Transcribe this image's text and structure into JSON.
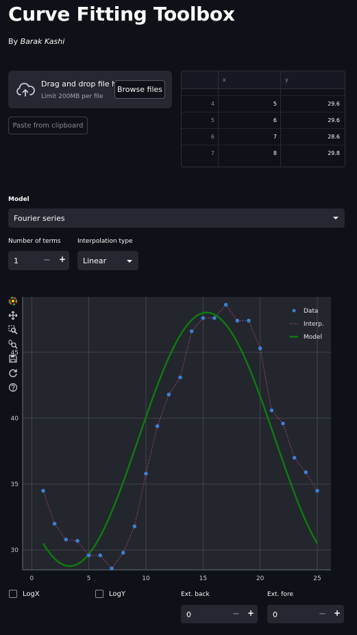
{
  "header": {
    "title": "Curve Fitting Toolbox",
    "by": "By",
    "author": "Barak Kashi"
  },
  "uploader": {
    "title": "Drag and drop file here",
    "limit": "Limit 200MB per file",
    "browse_label": "Browse files",
    "icon": "cloud-upload-icon"
  },
  "paste_label": "Paste from clipboard",
  "table": {
    "columns": [
      "",
      "x",
      "y"
    ],
    "rows": [
      {
        "idx": "4",
        "x": "5",
        "y": "29.6"
      },
      {
        "idx": "5",
        "x": "6",
        "y": "29.6"
      },
      {
        "idx": "6",
        "x": "7",
        "y": "28.6"
      },
      {
        "idx": "7",
        "x": "8",
        "y": "29.8"
      }
    ]
  },
  "model": {
    "label": "Model",
    "value": "Fourier series"
  },
  "nterms": {
    "label": "Number of terms",
    "value": "1",
    "minus": "−",
    "plus": "+"
  },
  "interp": {
    "label": "Interpolation type",
    "value": "Linear"
  },
  "options": {
    "logx": "LogX",
    "logy": "LogY",
    "ext_back": {
      "label": "Ext. back",
      "value": "0",
      "minus": "−",
      "plus": "+"
    },
    "ext_fore": {
      "label": "Ext. fore",
      "value": "0",
      "minus": "−",
      "plus": "+"
    }
  },
  "colors": {
    "data": "#3d7fd6",
    "interp": "#c94a8c",
    "model": "#0f7a0f",
    "plot_bg": "#23262d"
  },
  "toolbar_icons": [
    "bokeh-logo-icon",
    "pan-icon",
    "box-zoom-icon",
    "wheel-zoom-icon",
    "save-icon",
    "reset-icon",
    "help-icon"
  ],
  "chart_data": {
    "type": "scatter",
    "title": "",
    "xlabel": "",
    "ylabel": "",
    "xlim": [
      -0.8,
      26.2
    ],
    "ylim": [
      28.5,
      49.2
    ],
    "xticks": [
      0,
      5,
      10,
      15,
      20,
      25
    ],
    "yticks": [
      30,
      35,
      40,
      45
    ],
    "legend_position": "top-right",
    "series": [
      {
        "name": "Data",
        "kind": "points",
        "x": [
          1,
          2,
          3,
          4,
          5,
          6,
          7,
          8,
          9,
          10,
          11,
          12,
          13,
          14,
          15,
          16,
          17,
          18,
          19,
          20,
          21,
          22,
          23,
          24,
          25
        ],
        "y": [
          34.5,
          32.0,
          30.8,
          30.7,
          29.6,
          29.6,
          28.6,
          29.8,
          31.8,
          35.8,
          39.4,
          41.8,
          43.1,
          46.6,
          47.6,
          47.6,
          48.6,
          47.4,
          47.4,
          45.3,
          40.6,
          39.6,
          37.0,
          35.9,
          34.5
        ]
      },
      {
        "name": "Interp.",
        "kind": "dotted-line",
        "same_as": "Data"
      },
      {
        "name": "Model",
        "kind": "line",
        "function": "fourier-1",
        "a0": 38.4,
        "a1": -6.2,
        "b1": -7.35,
        "w": 0.2618,
        "x_range": [
          1,
          25
        ]
      }
    ]
  }
}
